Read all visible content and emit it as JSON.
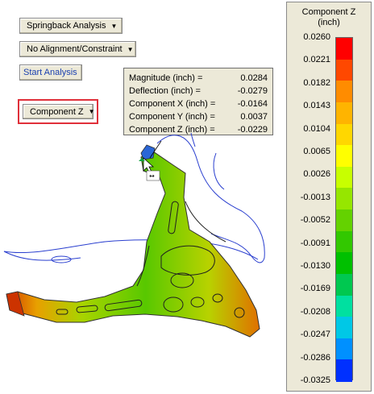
{
  "buttons": {
    "analysis_type": "Springback Analysis",
    "alignment": "No Alignment/Constraint",
    "start": "Start Analysis",
    "component": "Component Z"
  },
  "tooltip": {
    "rows": [
      {
        "label": "Magnitude (inch) =",
        "value": "0.0284"
      },
      {
        "label": "Deflection (inch) =",
        "value": "-0.0279"
      },
      {
        "label": "Component X (inch) =",
        "value": "-0.0164"
      },
      {
        "label": "Component Y (inch) =",
        "value": "0.0037"
      },
      {
        "label": "Component Z (inch) =",
        "value": "-0.0229"
      }
    ]
  },
  "legend": {
    "title_line1": "Component Z",
    "title_line2": "(inch)",
    "labels": [
      "0.0260",
      "0.0221",
      "0.0182",
      "0.0143",
      "0.0104",
      "0.0065",
      "0.0026",
      "-0.0013",
      "-0.0052",
      "-0.0091",
      "-0.0130",
      "-0.0169",
      "-0.0208",
      "-0.0247",
      "-0.0286",
      "-0.0325"
    ],
    "colors": [
      "#ff0000",
      "#ff4800",
      "#ff8c00",
      "#ffb400",
      "#ffd700",
      "#ffff00",
      "#c8ff00",
      "#96e600",
      "#64d200",
      "#32c800",
      "#00c000",
      "#00c850",
      "#00e0a0",
      "#00c8e6",
      "#0090ff",
      "#0030ff"
    ]
  }
}
